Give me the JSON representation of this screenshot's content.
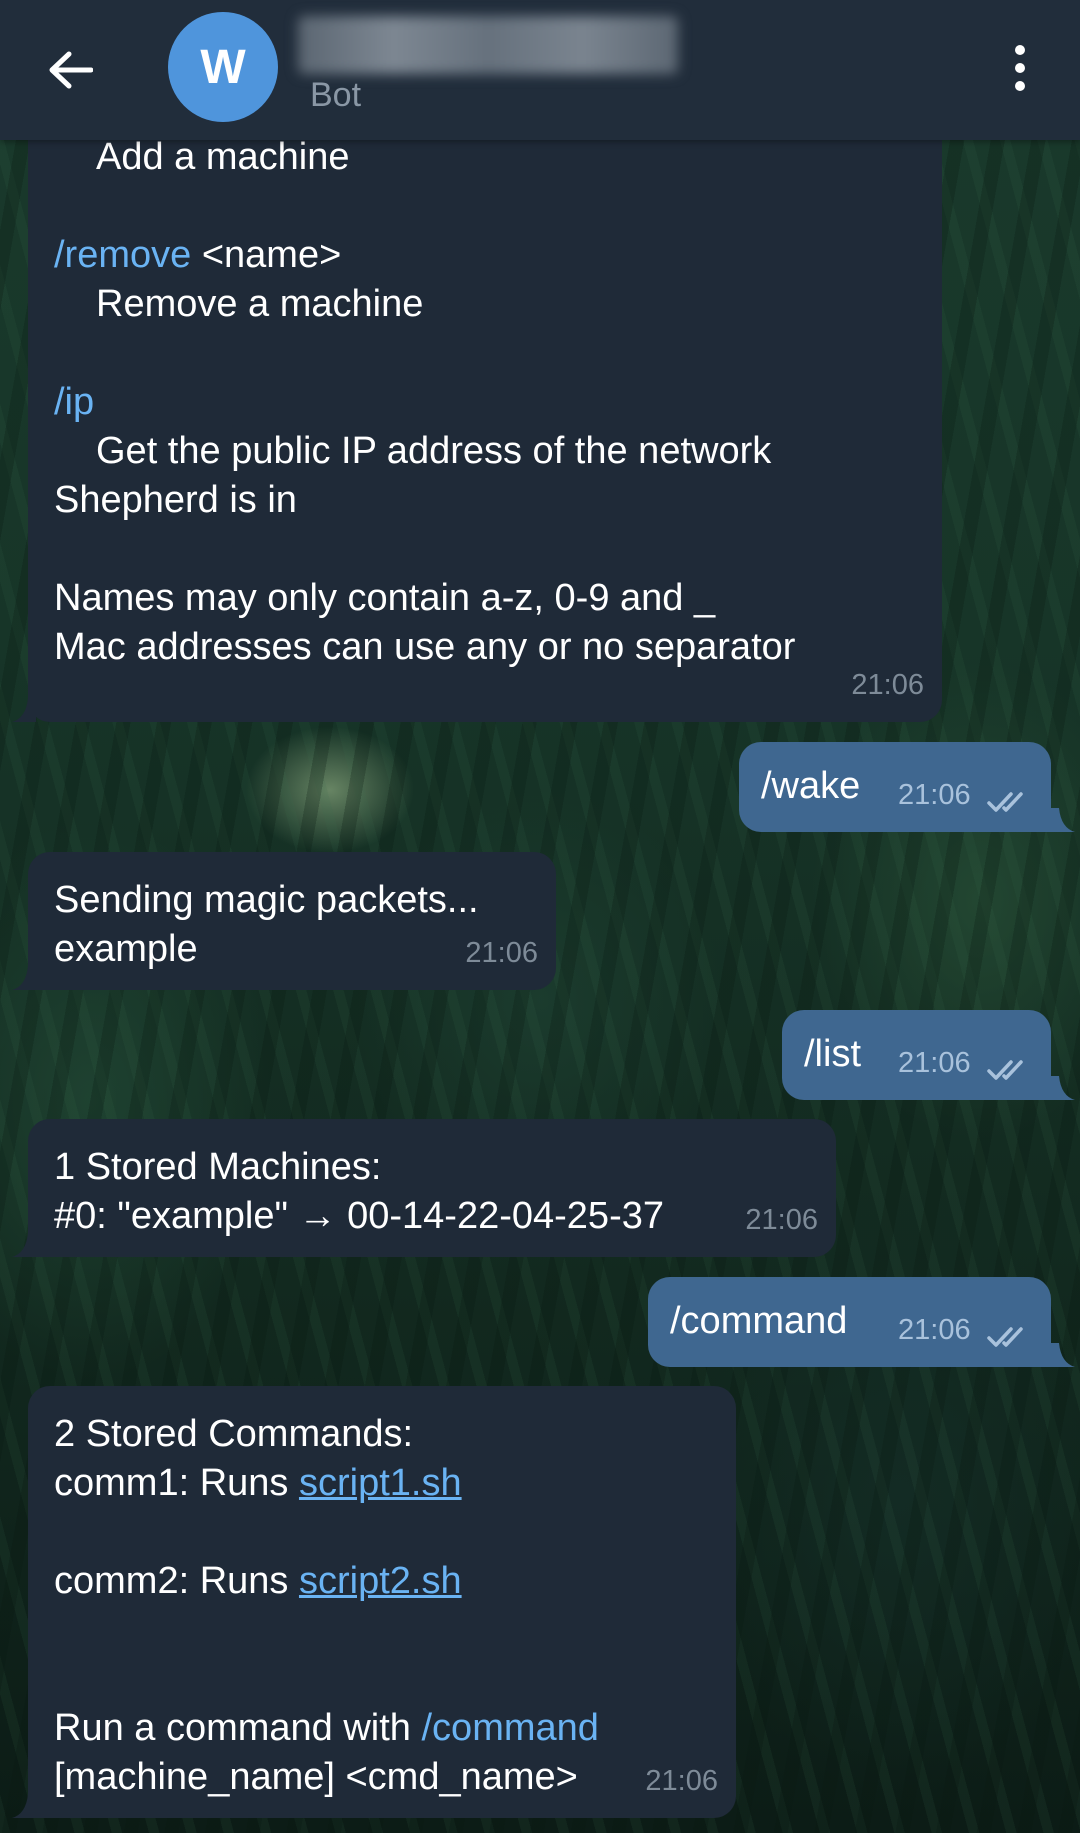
{
  "header": {
    "avatar_letter": "W",
    "subtitle": "Bot"
  },
  "messages": {
    "help": {
      "line1": "Add a machine",
      "remove_cmd": "/remove",
      "remove_arg": " <name>",
      "remove_desc": "Remove a machine",
      "ip_cmd": "/ip",
      "ip_desc1": "Get the public IP address of the network",
      "ip_desc2": "Shepherd is in",
      "note1": "Names may only contain a-z, 0-9 and _",
      "note2": "Mac addresses can use any or no separator",
      "time": "21:06"
    },
    "wake": {
      "text": "/wake",
      "time": "21:06"
    },
    "sending": {
      "line1": "Sending magic packets...",
      "line2": "example",
      "time": "21:06"
    },
    "list": {
      "text": "/list",
      "time": "21:06"
    },
    "machines": {
      "line1": "1 Stored Machines:",
      "line2": "#0: \"example\" → 00-14-22-04-25-37",
      "time": "21:06"
    },
    "command": {
      "text": "/command",
      "time": "21:06"
    },
    "commands": {
      "line1": "2 Stored Commands:",
      "comm1_prefix": "comm1: Runs ",
      "comm1_link": "script1.sh",
      "comm2_prefix": "comm2: Runs ",
      "comm2_link": "script2.sh",
      "run_prefix": "Run a command with ",
      "run_cmd": "/command",
      "run_line2": "[machine_name] <cmd_name>",
      "time": "21:06"
    }
  },
  "colors": {
    "header_bg": "#212d3b",
    "incoming_bubble": "#1f2a38",
    "outgoing_bubble": "#3f6790",
    "link": "#6ab3f3",
    "avatar": "#4f95dc"
  }
}
